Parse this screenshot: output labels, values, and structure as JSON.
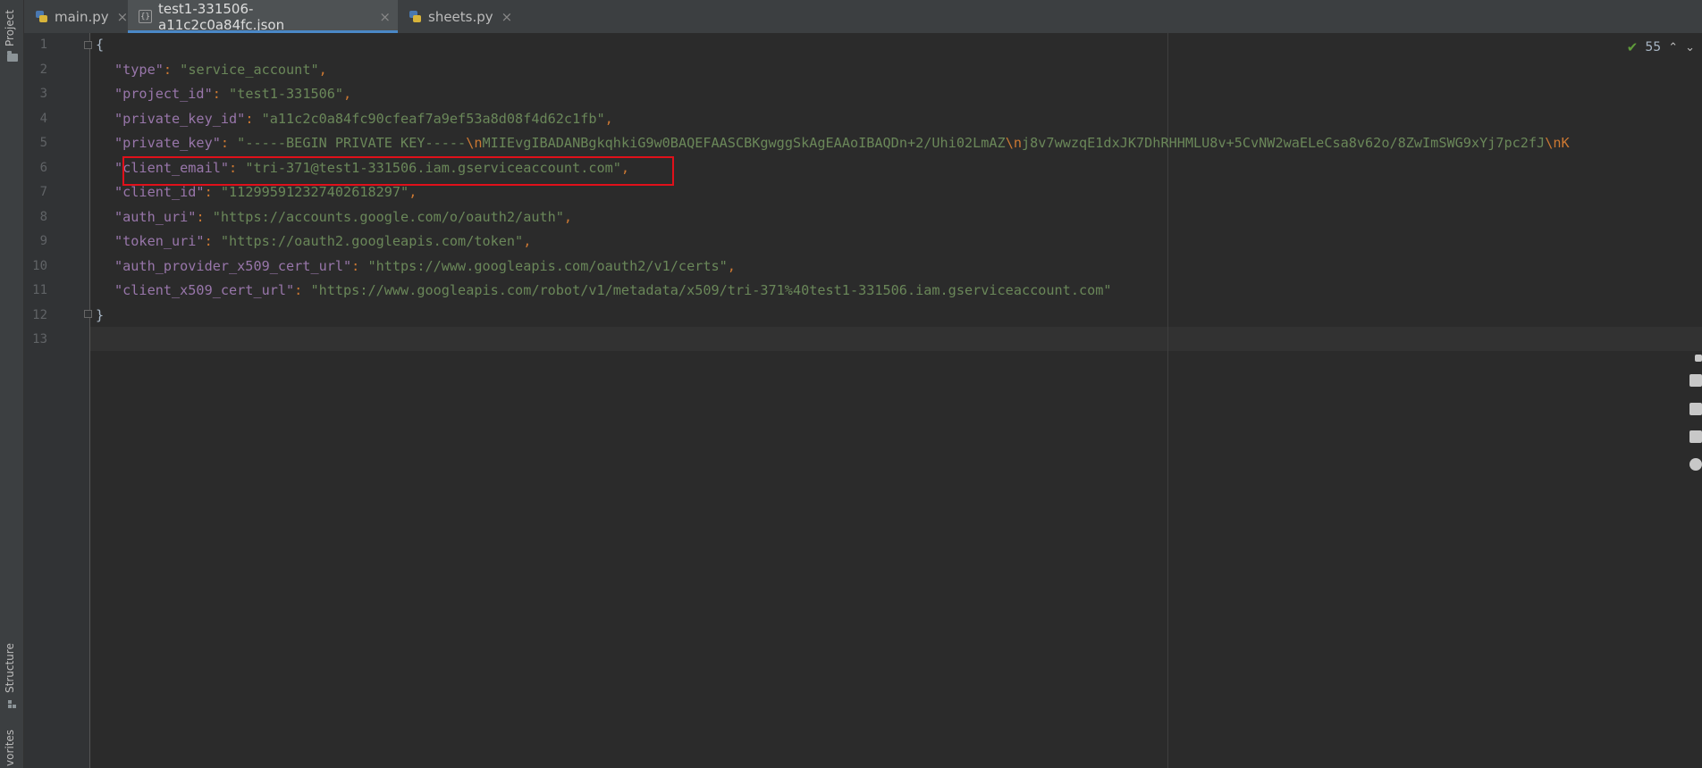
{
  "left_strip": {
    "project_label": "Project",
    "structure_label": "Structure",
    "favorites_label": "vorites"
  },
  "tabs": [
    {
      "label": "main.py",
      "icon": "python-file-icon",
      "active": false
    },
    {
      "label": "test1-331506-a11c2c0a84fc.json",
      "icon": "json-file-icon",
      "active": true
    },
    {
      "label": "sheets.py",
      "icon": "python-file-icon",
      "active": false
    }
  ],
  "inspection": {
    "count": "55"
  },
  "line_numbers": [
    "1",
    "2",
    "3",
    "4",
    "5",
    "6",
    "7",
    "8",
    "9",
    "10",
    "11",
    "12",
    "13"
  ],
  "lines": {
    "l1": {
      "brace": "{"
    },
    "l2": {
      "key": "\"type\"",
      "value": "\"service_account\""
    },
    "l3": {
      "key": "\"project_id\"",
      "value": "\"test1-331506\""
    },
    "l4": {
      "key": "\"private_key_id\"",
      "value": "\"a11c2c0a84fc90cfeaf7a9ef53a8d08f4d62c1fb\""
    },
    "l5": {
      "key": "\"private_key\"",
      "v1": "\"-----BEGIN PRIVATE KEY-----",
      "esc1": "\\n",
      "v2": "MIIEvgIBADANBgkqhkiG9w0BAQEFAASCBKgwggSkAgEAAoIBAQDn+2/Uhi02LmAZ",
      "esc2": "\\n",
      "v3": "j8v7wwzqE1dxJK7DhRHHMLU8v+5CvNW2waELeCsa8v62o/8ZwImSWG9xYj7pc2fJ",
      "esc3": "\\nK"
    },
    "l6": {
      "key": "\"client_email\"",
      "value": "\"tri-371@test1-331506.iam.gserviceaccount.com\""
    },
    "l7": {
      "key": "\"client_id\"",
      "value": "\"112995912327402618297\""
    },
    "l8": {
      "key": "\"auth_uri\"",
      "value": "\"https://accounts.google.com/o/oauth2/auth\""
    },
    "l9": {
      "key": "\"token_uri\"",
      "value": "\"https://oauth2.googleapis.com/token\""
    },
    "l10": {
      "key": "\"auth_provider_x509_cert_url\"",
      "value": "\"https://www.googleapis.com/oauth2/v1/certs\""
    },
    "l11": {
      "key": "\"client_x509_cert_url\"",
      "value": "\"https://www.googleapis.com/robot/v1/metadata/x509/tri-371%40test1-331506.iam.gserviceaccount.com\""
    },
    "l12": {
      "brace": "}"
    }
  },
  "colors": {
    "key": "#9876aa",
    "string": "#6a8759",
    "punctuation": "#cc7832",
    "highlight_box": "#e0101a",
    "active_tab_underline": "#4a88c7"
  }
}
